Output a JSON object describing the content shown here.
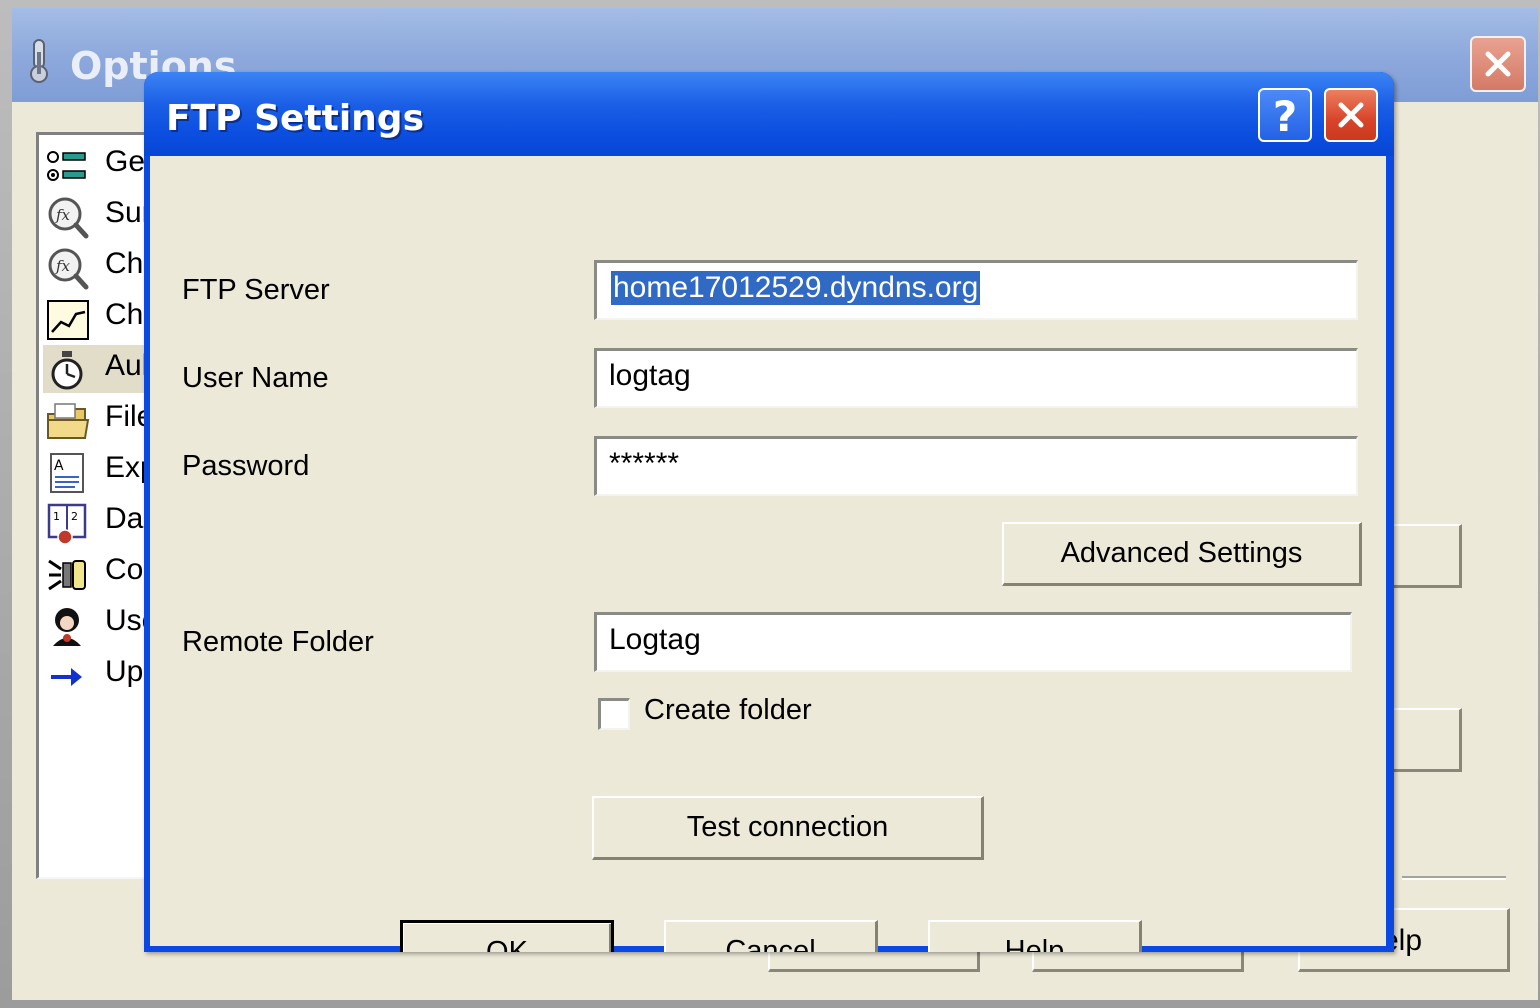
{
  "options_window": {
    "title": "Options",
    "list_items": [
      {
        "label": "Ger",
        "icon": "radio-list-icon"
      },
      {
        "label": "Sur",
        "icon": "function-magnifier-icon"
      },
      {
        "label": "Ch",
        "icon": "function-magnifier-icon"
      },
      {
        "label": "Ch",
        "icon": "line-chart-icon"
      },
      {
        "label": "Aul",
        "icon": "stopwatch-icon"
      },
      {
        "label": "File",
        "icon": "folder-icon"
      },
      {
        "label": "Exp",
        "icon": "document-text-icon"
      },
      {
        "label": "Dal",
        "icon": "calendar-icon"
      },
      {
        "label": "Co",
        "icon": "broadcast-icon"
      },
      {
        "label": "Use",
        "icon": "user-icon"
      },
      {
        "label": "Up",
        "icon": "arrow-right-icon"
      }
    ],
    "help_button_label": "elp"
  },
  "ftp_dialog": {
    "title": "FTP Settings",
    "help_title_symbol": "?",
    "fields": {
      "ftp_server": {
        "label": "FTP Server",
        "value": "home17012529.dyndns.org"
      },
      "user_name": {
        "label": "User Name",
        "value": "logtag"
      },
      "password": {
        "label": "Password",
        "value": "******"
      },
      "remote_folder": {
        "label": "Remote Folder",
        "value": "Logtag"
      }
    },
    "advanced_settings_label": "Advanced Settings",
    "create_folder_label": "Create folder",
    "create_folder_checked": false,
    "test_connection_label": "Test connection",
    "ok_label": "OK",
    "cancel_label": "Cancel",
    "help_label": "Help"
  },
  "colors": {
    "dialog_title_blue": "#0b4ee0",
    "selection_highlight": "#316ac5",
    "window_face": "#ece9d8",
    "close_red": "#d9442a"
  }
}
